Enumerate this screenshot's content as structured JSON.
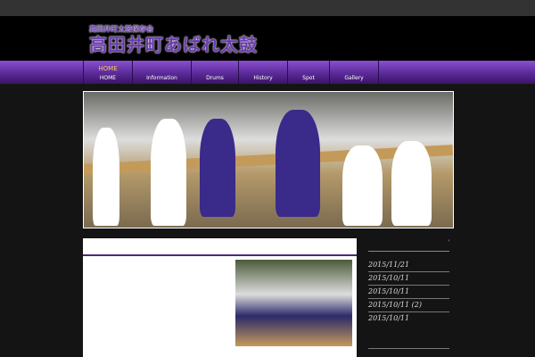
{
  "header": {
    "subtitle": "高田井町太鼓保存会",
    "title": "高田井町あばれ太鼓"
  },
  "nav": [
    {
      "jp": "HOME",
      "label": "HOME"
    },
    {
      "label": "Information"
    },
    {
      "label": "Drums"
    },
    {
      "label": "History"
    },
    {
      "label": "Spot"
    },
    {
      "label": "Gallery"
    }
  ],
  "sidebar": {
    "heading": "'",
    "posts": [
      "2015/11/21",
      "2015/10/11",
      "2015/10/11",
      "2015/10/11 (2)",
      "2015/10/11"
    ]
  }
}
